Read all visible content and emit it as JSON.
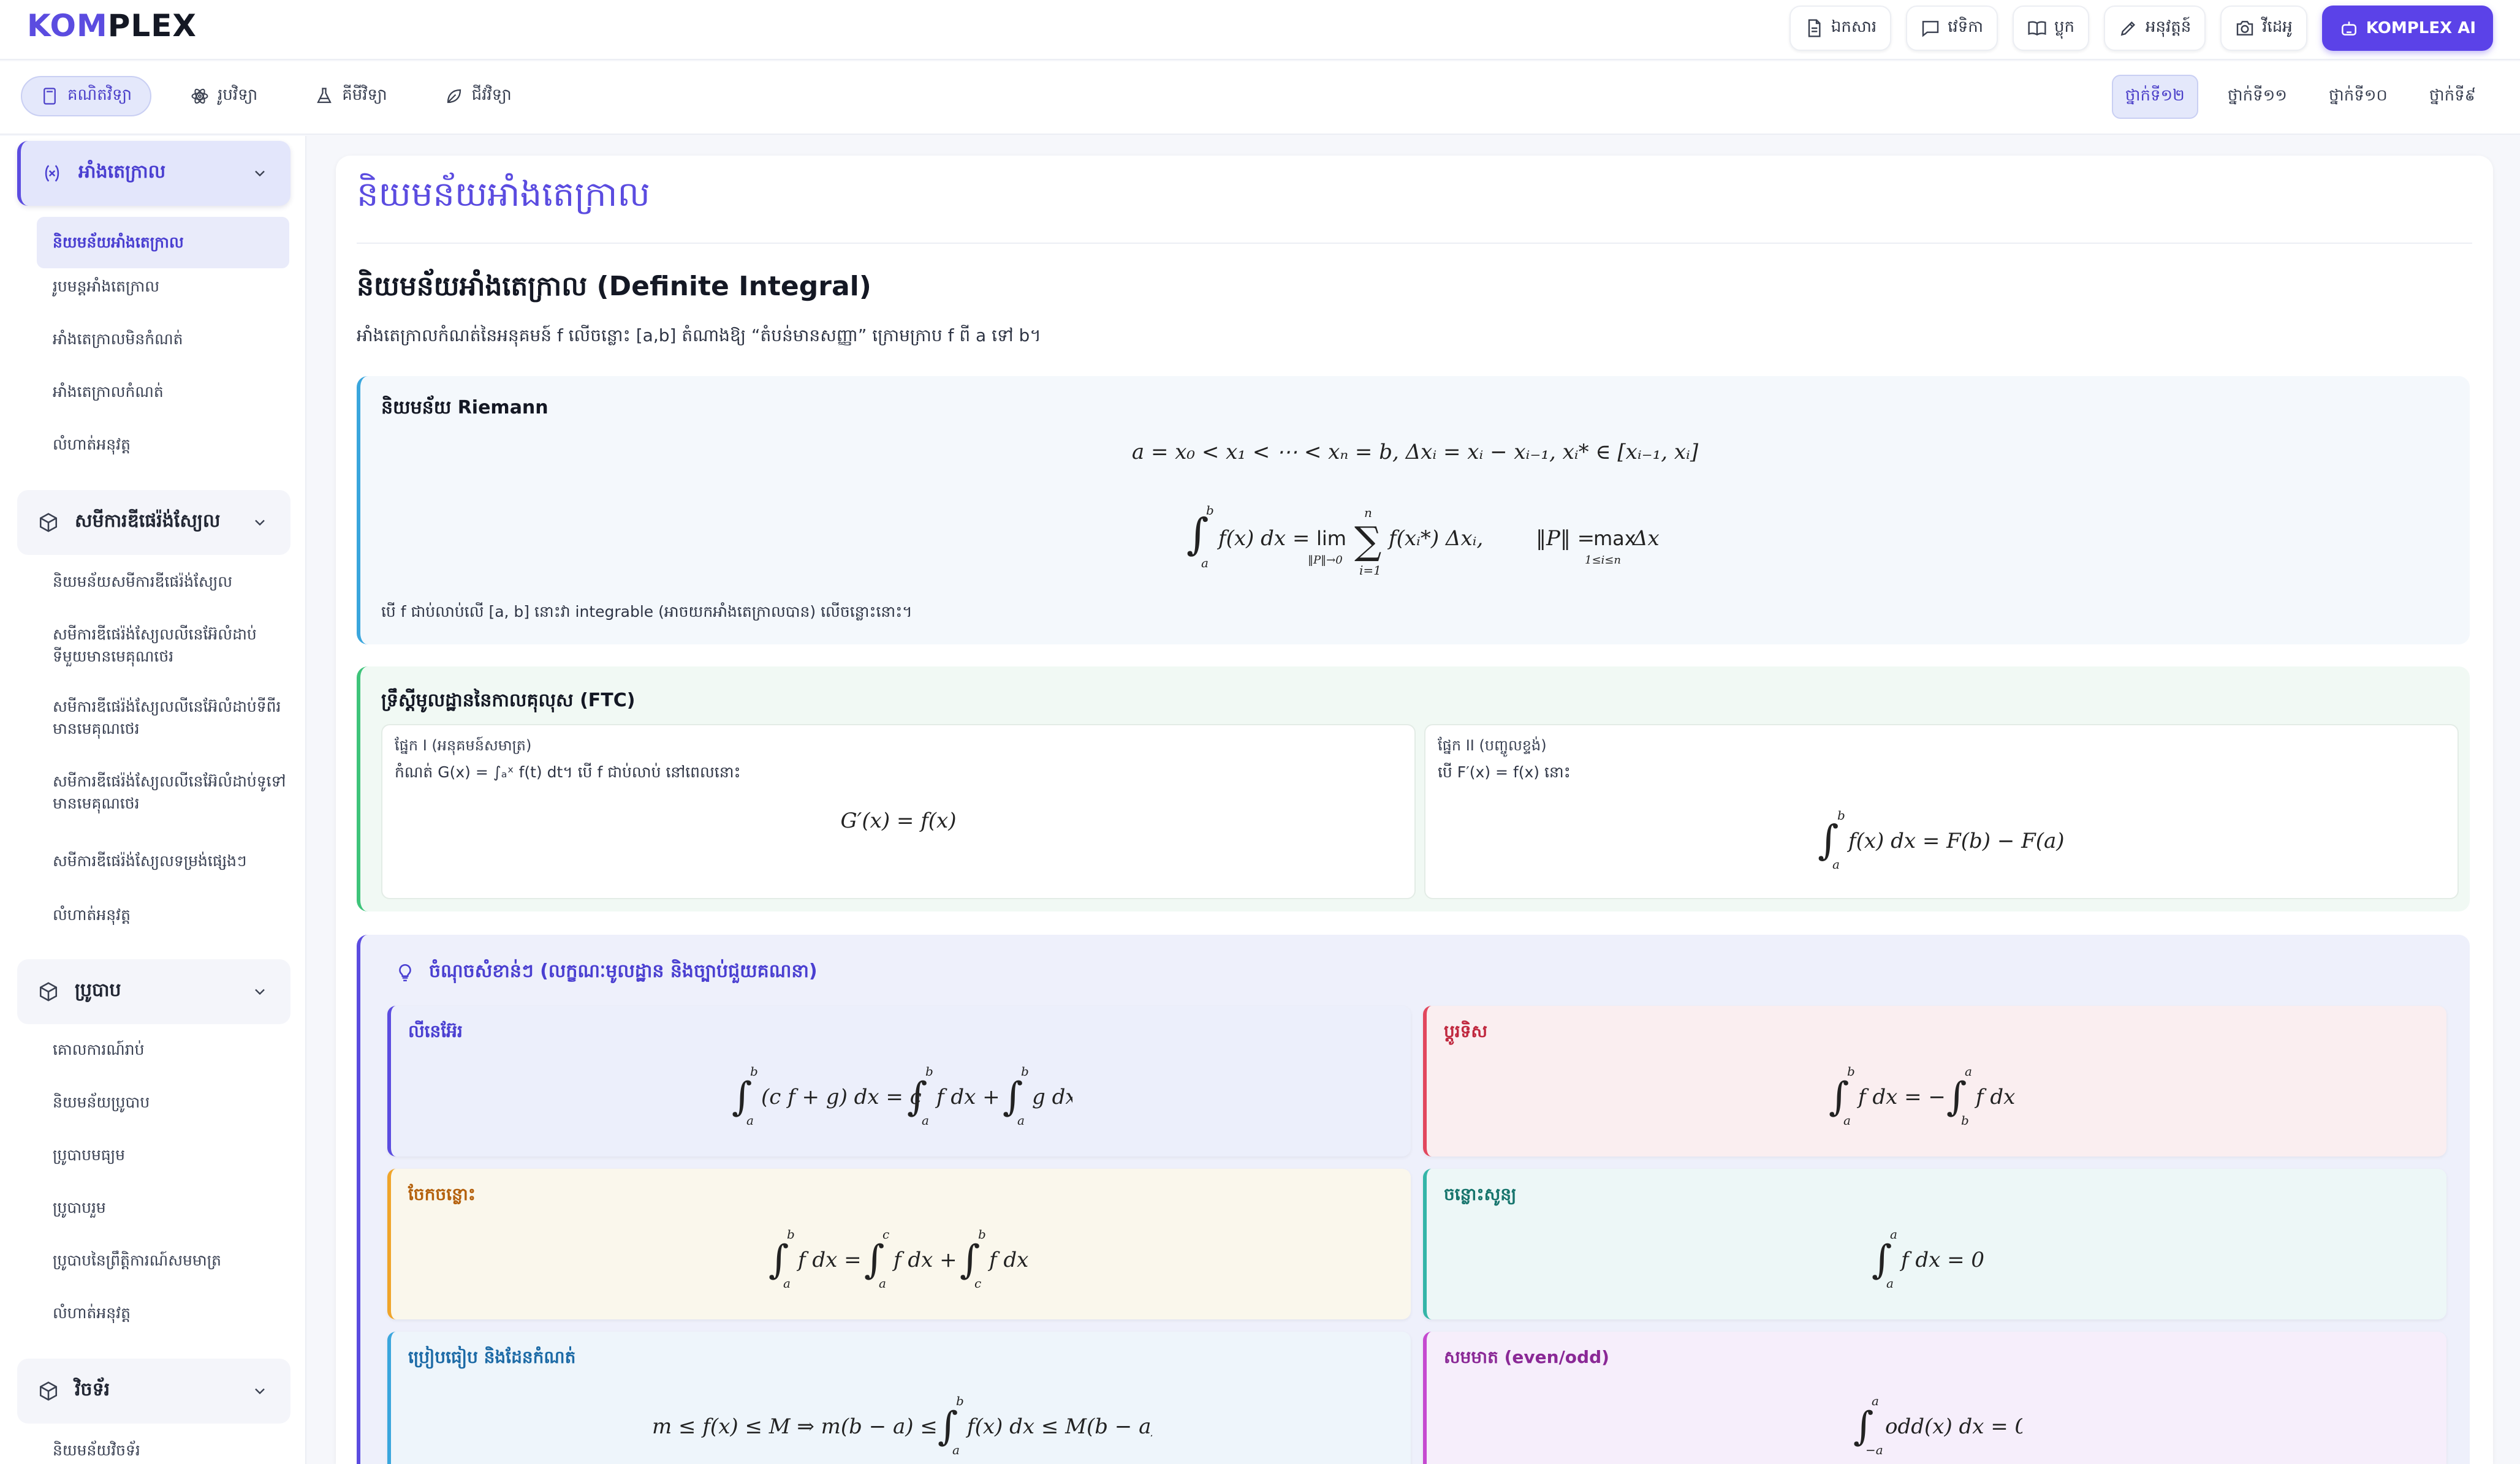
{
  "brand": {
    "part1": "KOM",
    "part2": "PLEX"
  },
  "top_actions": [
    {
      "label": "ឯកសារ",
      "icon": "document-icon"
    },
    {
      "label": "វេទិកា",
      "icon": "chat-icon"
    },
    {
      "label": "ប្លុក",
      "icon": "book-icon"
    },
    {
      "label": "អនុវត្តន៍",
      "icon": "pencil-icon"
    },
    {
      "label": "វីដេអូ",
      "icon": "camera-icon"
    },
    {
      "label": "KOMPLEX AI",
      "icon": "robot-icon"
    }
  ],
  "subjects": [
    {
      "label": "គណិតវិទ្យា",
      "icon": "calculator-icon",
      "active": true
    },
    {
      "label": "រូបវិទ្យា",
      "icon": "atom-icon"
    },
    {
      "label": "គីមីវិទ្យា",
      "icon": "flask-icon"
    },
    {
      "label": "ជីវវិទ្យា",
      "icon": "leaf-icon"
    }
  ],
  "grades": [
    {
      "label": "ថ្នាក់ទី១២",
      "active": true
    },
    {
      "label": "ថ្នាក់ទី១១"
    },
    {
      "label": "ថ្នាក់ទី១០"
    },
    {
      "label": "ថ្នាក់ទី៩"
    }
  ],
  "sidebar": {
    "sections": [
      {
        "title": "អាំងតេក្រាល",
        "icon": "variable-icon",
        "active": true,
        "items": [
          "និយមន័យអាំងតេក្រាល",
          "រូបមន្តអាំងតេក្រាល",
          "អាំងតេក្រាលមិនកំណត់",
          "អាំងតេក្រាលកំណត់",
          "លំហាត់អនុវត្ត"
        ]
      },
      {
        "title": "សមីការឌីផេរ៉ង់ស្យែល",
        "icon": "cube-icon",
        "items": [
          "និយមន័យសមីការឌីផេរ៉ង់ស្យែល",
          "សមីការឌីផេរ៉ង់ស្យែលលីនេអ៊ែលំដាប់ទីមួយមានមេគុណថេរ",
          "សមីការឌីផេរ៉ង់ស្យែលលីនេអ៊ែលំដាប់ទីពីរមានមេគុណថេរ",
          "សមីការឌីផេរ៉ង់ស្យែលលីនេអ៊ែលំដាប់ទូទៅមានមេគុណថេរ",
          "សមីការឌីផេរ៉ង់ស្យែលទម្រង់ផ្សេងៗ",
          "លំហាត់អនុវត្ត"
        ]
      },
      {
        "title": "ប្រូបាប",
        "icon": "cube-icon",
        "items": [
          "គោលការណ៍រាប់",
          "និយមន័យប្រូបាប",
          "ប្រូបាបមធ្យម",
          "ប្រូបាបរួម",
          "ប្រូបាបនៃព្រឹត្តិការណ៍សមមាត្រ",
          "លំហាត់អនុវត្ត"
        ]
      },
      {
        "title": "វិចទ័រ",
        "icon": "cube-icon",
        "items": [
          "និយមន័យវិចទ័រ"
        ]
      }
    ]
  },
  "main": {
    "page_title": "និយមន័យអាំងតេក្រាល",
    "heading": "និយមន័យអាំងតេក្រាល (Definite Integral)",
    "intro": "អាំងតេក្រាលកំណត់នៃអនុគមន៍ f លើចន្លោះ [a,b] តំណាងឱ្យ “តំបន់មានសញ្ញា” ក្រោមក្រាប f ពី a ទៅ b។",
    "riemann": {
      "title": "និយមន័យ Riemann",
      "partition_eq": "a = x₀ < x₁ < ⋯ < xₙ = b,    Δxᵢ = xᵢ − xᵢ₋₁,    xᵢ* ∈ [xᵢ₋₁, xᵢ]",
      "note": "បើ f ជាប់លាប់លើ [a, b] នោះវា integrable (អាចយកអាំងតេក្រាលបាន) លើចន្លោះនោះ។"
    },
    "ftc": {
      "title": "ទ្រឹស្តីមូលដ្ឋាននៃកាលគុលុស (FTC)",
      "part1_title": "ផ្នែក I (អនុគមន៍សមាត្រ)",
      "part1_text": "កំណត់ G(x) = ∫ₐˣ f(t) dt។ បើ f ជាប់លាប់ នៅពេលនោះ",
      "part1_eq": "G′(x) = f(x)",
      "part2_title": "ផ្នែក II (បញ្ចូលខ្ទង់)",
      "part2_text": "បើ F′(x) = f(x) នោះ"
    },
    "keypoints": {
      "title": "ចំណុចសំខាន់ៗ (លក្ខណៈមូលដ្ឋាន និងច្បាប់ជួយគណនា)",
      "linear": "លីនេអ៊ែរ",
      "flip": "ប្តូរទិស",
      "split": "ចែកចន្លោះ",
      "zero": "ចន្លោះសូន្យ",
      "bound": "ប្រៀបធៀប និងដែនកំណត់",
      "sym": "សមមាត (even/odd)"
    }
  },
  "colors": {
    "accent": "#5b4ce0",
    "ai_button": "#5b42e8"
  }
}
